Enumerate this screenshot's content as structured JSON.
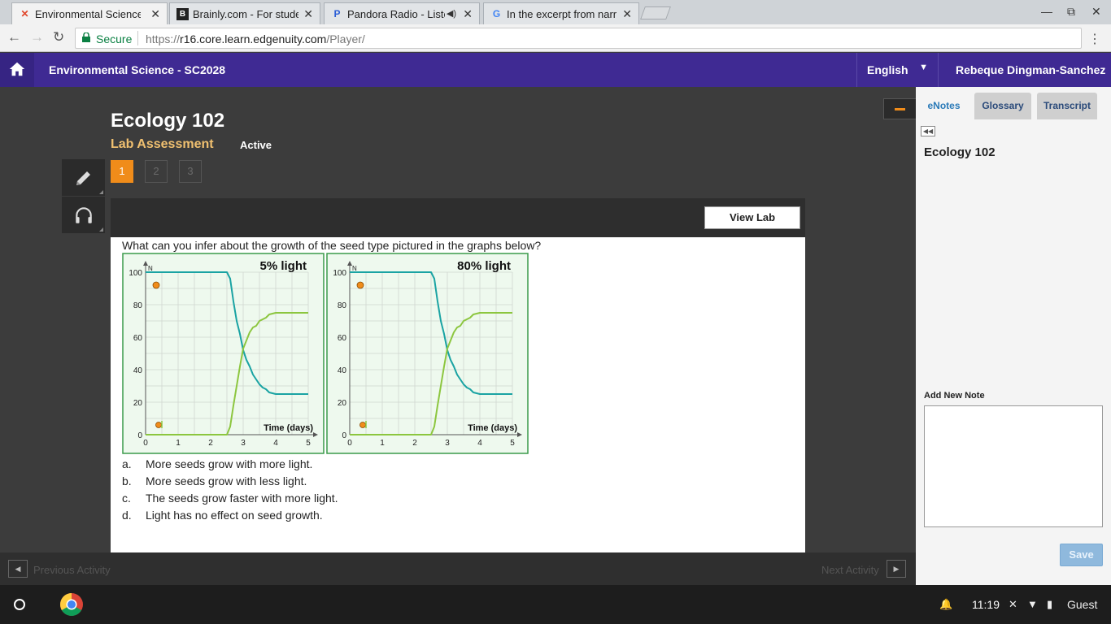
{
  "browser": {
    "tabs": [
      {
        "title": "Environmental Science -",
        "active": true,
        "favicon": "edgenuity-icon"
      },
      {
        "title": "Brainly.com - For studen",
        "active": false,
        "favicon": "brainly-icon"
      },
      {
        "title": "Pandora Radio - Liste",
        "active": false,
        "favicon": "pandora-icon"
      },
      {
        "title": "In the excerpt from narra",
        "active": false,
        "favicon": "google-icon"
      }
    ],
    "secure_label": "Secure",
    "url_scheme": "https://",
    "url_host": "r16.core.learn.edgenuity.com",
    "url_path": "/Player/"
  },
  "header": {
    "course_title": "Environmental Science - SC2028",
    "language": "English",
    "username": "Rebeque Dingman-Sanchez"
  },
  "lesson": {
    "title": "Ecology 102",
    "subtitle": "Lab Assessment",
    "status": "Active",
    "pages": [
      "1",
      "2",
      "3"
    ],
    "active_page": "1",
    "view_lab_label": "View Lab"
  },
  "question": {
    "text": "What can you infer about the growth of the seed type pictured in the graphs below?",
    "answers": [
      {
        "letter": "a.",
        "text": "More seeds grow with more light."
      },
      {
        "letter": "b.",
        "text": "More seeds grow with less light."
      },
      {
        "letter": "c.",
        "text": "The seeds grow faster with more light."
      },
      {
        "letter": "d.",
        "text": "Light has no effect on seed growth."
      }
    ]
  },
  "chart_data": [
    {
      "type": "line",
      "title": "5% light",
      "xlabel": "Time (days)",
      "ylabel": "N",
      "xlim": [
        0,
        5
      ],
      "ylim": [
        0,
        100
      ],
      "xticks": [
        "0",
        "1",
        "2",
        "3",
        "4",
        "5"
      ],
      "yticks": [
        "0",
        "20",
        "40",
        "60",
        "80",
        "100"
      ],
      "grid": true,
      "series": [
        {
          "color": "#1aa3a3",
          "x": [
            0,
            2.5,
            2.6,
            2.7,
            2.8,
            2.9,
            3.0,
            3.1,
            3.2,
            3.3,
            3.4,
            3.5,
            3.6,
            3.7,
            3.8,
            4.0,
            5.0
          ],
          "y": [
            100,
            100,
            96,
            82,
            70,
            62,
            52,
            46,
            42,
            37,
            34,
            31,
            29,
            28,
            26,
            25,
            25
          ]
        },
        {
          "color": "#8cc63f",
          "x": [
            0,
            2.5,
            2.6,
            2.7,
            2.8,
            2.9,
            3.0,
            3.1,
            3.2,
            3.3,
            3.4,
            3.5,
            3.6,
            3.7,
            3.8,
            4.0,
            5.0
          ],
          "y": [
            0,
            0,
            5,
            18,
            30,
            42,
            53,
            58,
            63,
            66,
            67,
            70,
            71,
            72,
            74,
            75,
            75
          ]
        }
      ]
    },
    {
      "type": "line",
      "title": "80% light",
      "xlabel": "Time (days)",
      "ylabel": "N",
      "xlim": [
        0,
        5
      ],
      "ylim": [
        0,
        100
      ],
      "xticks": [
        "0",
        "1",
        "2",
        "3",
        "4",
        "5"
      ],
      "yticks": [
        "0",
        "20",
        "40",
        "60",
        "80",
        "100"
      ],
      "grid": true,
      "series": [
        {
          "color": "#1aa3a3",
          "x": [
            0,
            2.5,
            2.6,
            2.7,
            2.8,
            2.9,
            3.0,
            3.1,
            3.2,
            3.3,
            3.4,
            3.5,
            3.6,
            3.7,
            3.8,
            4.0,
            5.0
          ],
          "y": [
            100,
            100,
            96,
            82,
            70,
            62,
            52,
            46,
            42,
            37,
            34,
            31,
            29,
            28,
            26,
            25,
            25
          ]
        },
        {
          "color": "#8cc63f",
          "x": [
            0,
            2.5,
            2.6,
            2.7,
            2.8,
            2.9,
            3.0,
            3.1,
            3.2,
            3.3,
            3.4,
            3.5,
            3.6,
            3.7,
            3.8,
            4.0,
            5.0
          ],
          "y": [
            0,
            0,
            5,
            18,
            30,
            42,
            53,
            58,
            63,
            66,
            67,
            70,
            71,
            72,
            74,
            75,
            75
          ]
        }
      ]
    }
  ],
  "footer": {
    "previous_label": "Previous Activity",
    "next_label": "Next Activity"
  },
  "sidebar": {
    "tabs": [
      "eNotes",
      "Glossary",
      "Transcript"
    ],
    "active_tab": "eNotes",
    "title": "Ecology 102",
    "add_note_label": "Add New Note",
    "note_value": "",
    "save_label": "Save"
  },
  "shelf": {
    "time": "11:19",
    "user": "Guest"
  },
  "colors": {
    "header_purple": "#3f2a93",
    "accent_orange": "#f08c1a",
    "graph_bg": "#eef9ee",
    "graph_border": "#3a9a4a",
    "teal_series": "#1aa3a3",
    "green_series": "#8cc63f"
  }
}
